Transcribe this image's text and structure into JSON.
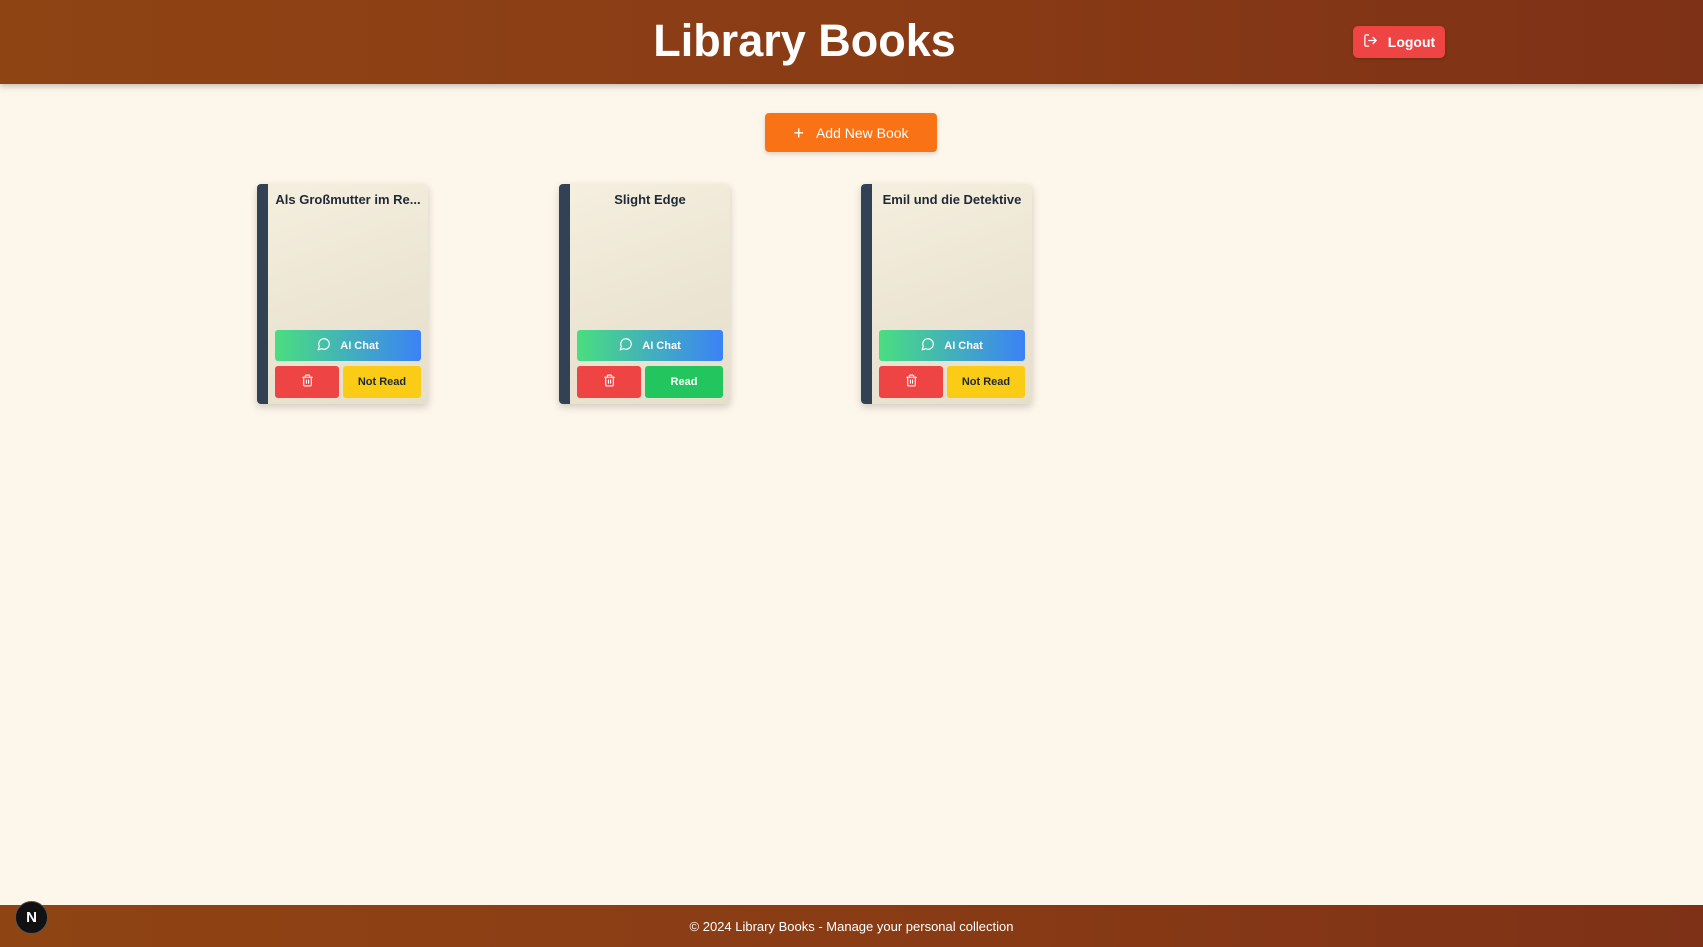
{
  "header": {
    "title": "Library Books",
    "logout_label": "Logout"
  },
  "actions": {
    "add_plus": "+",
    "add_label": "Add New Book"
  },
  "books": [
    {
      "title": "Als Großmutter im Re...",
      "ai_label": "AI Chat",
      "status_label": "Not Read",
      "status": "not-read"
    },
    {
      "title": "Slight Edge",
      "ai_label": "AI Chat",
      "status_label": "Read",
      "status": "read"
    },
    {
      "title": "Emil und die Detektive",
      "ai_label": "AI Chat",
      "status_label": "Not Read",
      "status": "not-read"
    }
  ],
  "footer": {
    "text": "© 2024 Library Books - Manage your personal collection"
  },
  "badge": {
    "letter": "N"
  },
  "colors": {
    "header_bg": "#8a3c15",
    "page_bg": "#fdf6ea",
    "accent_orange": "#f97316",
    "danger_red": "#ef4444",
    "read_green": "#22c55e",
    "not_read_yellow": "#facc15",
    "spine": "#334155"
  },
  "icons": {
    "logout": "logout-icon",
    "add": "plus-icon",
    "chat": "message-circle-icon",
    "delete": "trash-icon"
  }
}
